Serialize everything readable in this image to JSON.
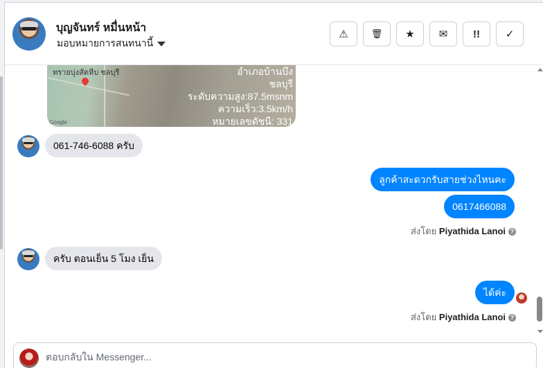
{
  "header": {
    "contact_name": "บุญจันทร์ หมื่นหน้า",
    "assign_label": "มอบหมายการสนทนานี้",
    "toolbar": {
      "spam_icon": "⚠",
      "delete_icon": "🗑",
      "star_icon": "★",
      "mail_icon": "✉",
      "follow_up_icon": "!!",
      "done_icon": "✓"
    }
  },
  "map": {
    "place_label": "ทรายบุ่งสัตหีบ ชลบุรี",
    "google_label": "Google",
    "overlay_lines": [
      "อำเภอบ้านบึง",
      "ชลบุรี",
      "ระดับความสูง:87.5msnm",
      "ความเร็ว:3.5km/h",
      "หมายเลขดัชนี: 331"
    ]
  },
  "messages": [
    {
      "direction": "in",
      "text": "061-746-6088 ครับ"
    },
    {
      "direction": "out",
      "text": "ลูกค้าสะดวกรับสายช่วงไหนคะ"
    },
    {
      "direction": "out",
      "text": "0617466088"
    },
    {
      "direction": "in",
      "text": "ครับ ตอนเย็น 5 โมง เย็น"
    },
    {
      "direction": "out",
      "text": "ได้ค่ะ"
    }
  ],
  "sent_by": {
    "prefix": "ส่งโดย",
    "name": "Piyathida Lanoi",
    "info_icon": "?"
  },
  "composer": {
    "placeholder": "ตอบกลับใน Messenger..."
  },
  "colors": {
    "outgoing_bubble": "#0084ff",
    "incoming_bubble": "#e4e6eb"
  }
}
